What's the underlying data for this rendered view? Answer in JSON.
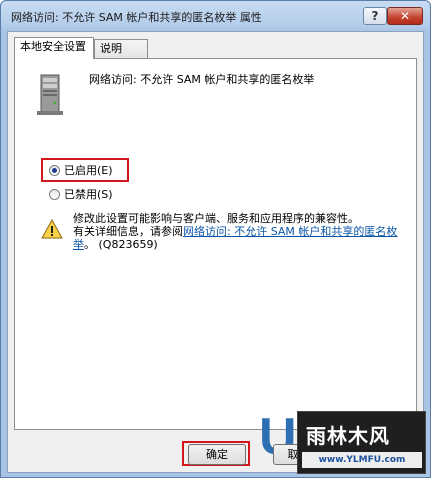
{
  "window": {
    "title": "网络访问: 不允许 SAM 帐户和共享的匿名枚举 属性",
    "help_label": "?",
    "close_label": "✕"
  },
  "tabs": [
    {
      "label": "本地安全设置",
      "active": true
    },
    {
      "label": "说明",
      "active": false
    }
  ],
  "policy": {
    "name": "网络访问: 不允许 SAM 帐户和共享的匿名枚举",
    "icon": "server-icon"
  },
  "options": {
    "enabled_label": "已启用(E)",
    "disabled_label": "已禁用(S)",
    "selected": "enabled"
  },
  "warning": {
    "icon": "warning-icon",
    "line1": "修改此设置可能影响与客户端、服务和应用程序的兼容性。",
    "prefix": "有关详细信息，请参阅",
    "link": "网络访问: 不允许 SAM 帐户和共享的匿名枚举",
    "suffix": "。 (Q823659)"
  },
  "buttons": {
    "ok_label": "确定",
    "cancel_label": "取"
  },
  "watermark": {
    "title": "雨林木风",
    "url": "www.YLMFU.com",
    "letter": "U"
  },
  "colors": {
    "highlight": "#d1171c",
    "link": "#0a55a8",
    "radio_dot": "#1e3d8f"
  }
}
